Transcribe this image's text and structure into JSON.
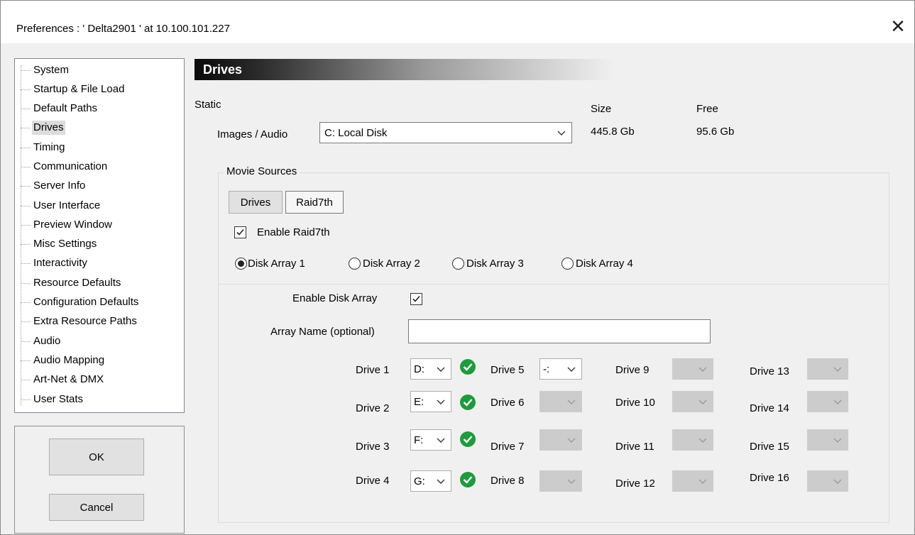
{
  "window": {
    "title": "Preferences  :  ' Delta2901 '  at  10.100.101.227",
    "close_glyph": "✕"
  },
  "tree": {
    "items": [
      {
        "label": "System"
      },
      {
        "label": "Startup & File Load"
      },
      {
        "label": "Default Paths"
      },
      {
        "label": "Drives",
        "selected": true
      },
      {
        "label": "Timing"
      },
      {
        "label": "Communication"
      },
      {
        "label": "Server Info"
      },
      {
        "label": "User Interface"
      },
      {
        "label": "Preview Window"
      },
      {
        "label": "Misc Settings"
      },
      {
        "label": "Interactivity"
      },
      {
        "label": "Resource Defaults"
      },
      {
        "label": "Configuration Defaults"
      },
      {
        "label": "Extra Resource Paths"
      },
      {
        "label": "Audio"
      },
      {
        "label": "Audio Mapping"
      },
      {
        "label": "Art-Net & DMX"
      },
      {
        "label": "User Stats"
      }
    ]
  },
  "buttons": {
    "ok": "OK",
    "cancel": "Cancel"
  },
  "drives": {
    "header": "Drives",
    "static_label": "Static",
    "size_header": "Size",
    "free_header": "Free",
    "images_audio_label": "Images / Audio",
    "images_audio_value": "C:  Local Disk",
    "size_value": "445.8 Gb",
    "free_value": "95.6 Gb"
  },
  "movie_sources": {
    "title": "Movie Sources",
    "tabs": [
      "Drives",
      "Raid7th"
    ],
    "active_tab": "Raid7th",
    "enable_raid_label": "Enable Raid7th",
    "enable_raid_checked": true,
    "disk_arrays": [
      "Disk Array 1",
      "Disk Array 2",
      "Disk Array 3",
      "Disk Array 4"
    ],
    "selected_array": "Disk Array 1",
    "enable_disk_array_label": "Enable Disk Array",
    "enable_disk_array_checked": true,
    "array_name_label": "Array Name (optional)",
    "array_name_value": ""
  },
  "drive_slots": [
    {
      "label": "Drive 1",
      "value": "D:",
      "status": "ok"
    },
    {
      "label": "Drive 2",
      "value": "E:",
      "status": "ok"
    },
    {
      "label": "Drive 3",
      "value": "F:",
      "status": "ok"
    },
    {
      "label": "Drive 4",
      "value": "G:",
      "status": "ok"
    },
    {
      "label": "Drive 5",
      "value": "-:",
      "status": "none"
    },
    {
      "label": "Drive 6",
      "value": "",
      "status": "disabled"
    },
    {
      "label": "Drive 7",
      "value": "",
      "status": "disabled"
    },
    {
      "label": "Drive 8",
      "value": "",
      "status": "disabled"
    },
    {
      "label": "Drive 9",
      "value": "",
      "status": "disabled"
    },
    {
      "label": "Drive 10",
      "value": "",
      "status": "disabled"
    },
    {
      "label": "Drive 11",
      "value": "",
      "status": "disabled"
    },
    {
      "label": "Drive 12",
      "value": "",
      "status": "disabled"
    },
    {
      "label": "Drive 13",
      "value": "",
      "status": "disabled"
    },
    {
      "label": "Drive 14",
      "value": "",
      "status": "disabled"
    },
    {
      "label": "Drive 15",
      "value": "",
      "status": "disabled"
    },
    {
      "label": "Drive 16",
      "value": "",
      "status": "disabled"
    }
  ],
  "colors": {
    "ok_green": "#1e9b3c",
    "selection_gray": "#dcdcdc",
    "disabled_combo": "#cccccc"
  }
}
